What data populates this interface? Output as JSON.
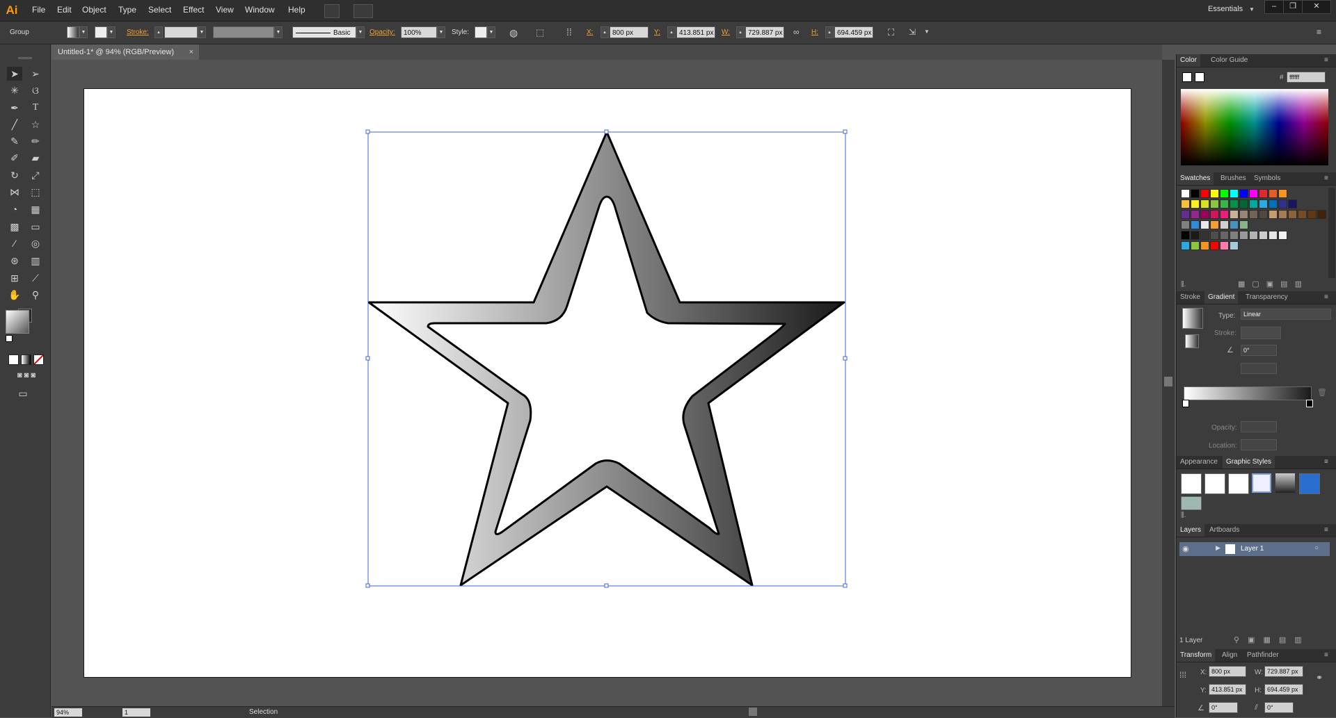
{
  "app": {
    "logo": "Ai",
    "workspace": "Essentials"
  },
  "menu": [
    "File",
    "Edit",
    "Object",
    "Type",
    "Select",
    "Effect",
    "View",
    "Window",
    "Help"
  ],
  "control": {
    "selection": "Group",
    "stroke_label": "Stroke:",
    "brush": "Basic",
    "opacity_label": "Opacity:",
    "opacity": "100%",
    "style_label": "Style:",
    "x_label": "X:",
    "x": "800 px",
    "y_label": "Y:",
    "y": "413.851 px",
    "w_label": "W:",
    "w": "729.887 px",
    "h_label": "H:",
    "h": "694.459 px"
  },
  "document": {
    "tab": "Untitled-1* @ 94% (RGB/Preview)"
  },
  "status": {
    "zoom": "94%",
    "artboard": "1",
    "tool": "Selection"
  },
  "panels": {
    "color": {
      "tabs": [
        "Color",
        "Color Guide"
      ],
      "hex_label": "#",
      "hex": "ffffff"
    },
    "swatches": {
      "tabs": [
        "Swatches",
        "Brushes",
        "Symbols"
      ]
    },
    "gradient": {
      "tabs": [
        "Stroke",
        "Gradient",
        "Transparency"
      ],
      "type_label": "Type:",
      "type": "Linear",
      "stroke_label": "Stroke:",
      "angle": "0°",
      "opacity_label": "Opacity:",
      "location_label": "Location:"
    },
    "styles": {
      "tabs": [
        "Appearance",
        "Graphic Styles"
      ]
    },
    "layers": {
      "tabs": [
        "Layers",
        "Artboards"
      ],
      "layer_name": "Layer 1",
      "count": "1 Layer"
    },
    "transform": {
      "tabs": [
        "Transform",
        "Align",
        "Pathfinder"
      ],
      "x_label": "X:",
      "x": "800 px",
      "y_label": "Y:",
      "y": "413.851 px",
      "w_label": "W:",
      "w": "729.887 px",
      "h_label": "H:",
      "h": "694.459 px",
      "rotate": "0°",
      "shear": "0°"
    }
  },
  "colors": {
    "accent_orange": "#f0a030",
    "selection_blue": "#4060e0",
    "swatch_rows": [
      [
        "#ffffff",
        "#000000",
        "#ff0000",
        "#ffff00",
        "#00ff00",
        "#00ffff",
        "#0000ff",
        "#ff00ff",
        "#e3272f",
        "#e85d21",
        "#f7931e"
      ],
      [
        "#f5c23a",
        "#fcee21",
        "#d9e021",
        "#8cc63f",
        "#39b54a",
        "#009245",
        "#006837",
        "#00a99d",
        "#29abe2",
        "#0071bc",
        "#2e3192",
        "#1b1464"
      ],
      [
        "#662d91",
        "#93278f",
        "#9e005d",
        "#d4145a",
        "#ed1e79",
        "#c7b299",
        "#998675",
        "#736357",
        "#534741",
        "#c69c6d",
        "#a67c52",
        "#8c6239",
        "#754c24",
        "#603813",
        "#42210b"
      ],
      [
        "#808080",
        "#2f8ad8",
        "#e8e8e8",
        "#f29e38",
        "#cfcfcf",
        "#4a90c0",
        "#8ab38a"
      ],
      [
        "#000000",
        "#1a1a1a",
        "#333333",
        "#4d4d4d",
        "#666666",
        "#808080",
        "#999999",
        "#b3b3b3",
        "#cccccc",
        "#e6e6e6",
        "#f2f2f2"
      ],
      [
        "#29abe2",
        "#8cc63f",
        "#f7931e",
        "#ff0000",
        "#ff7bac",
        "#a8c8e0"
      ]
    ]
  }
}
